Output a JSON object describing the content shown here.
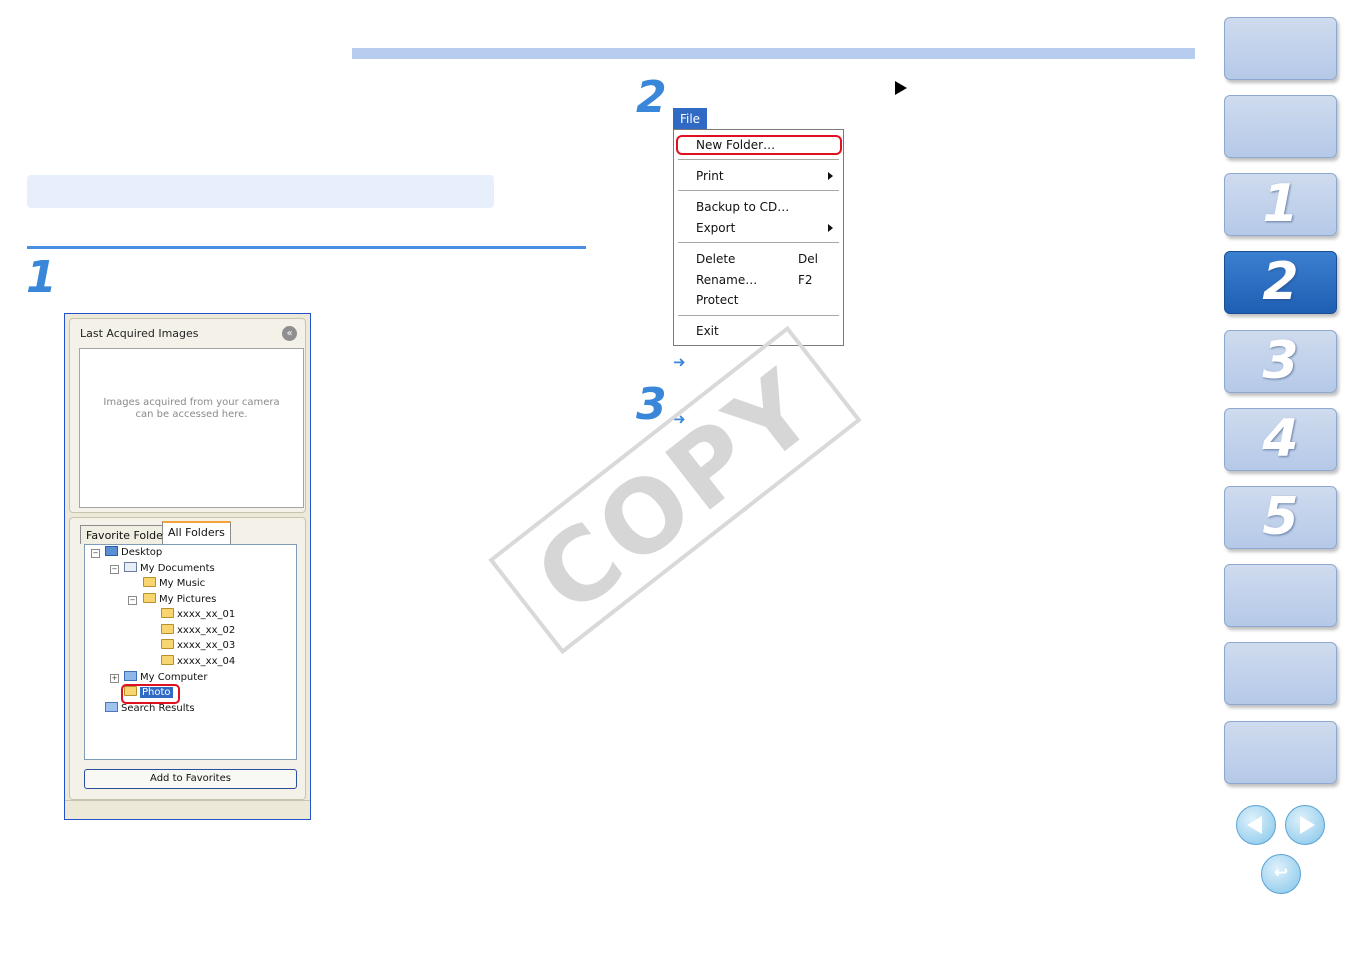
{
  "step1": {
    "number": "1"
  },
  "step2": {
    "number": "2"
  },
  "step3": {
    "number": "3"
  },
  "result_arrow": "➜",
  "browser_panel": {
    "last_acquired_title": "Last Acquired Images",
    "collapse_glyph": "«",
    "placeholder_line1": "Images acquired from your camera",
    "placeholder_line2": "can be accessed here.",
    "tabs": {
      "favorites": "Favorite Folders",
      "all": "All Folders"
    },
    "tree": {
      "desktop": "Desktop",
      "my_documents": "My Documents",
      "my_music": "My Music",
      "my_pictures": "My Pictures",
      "f1": "xxxx_xx_01",
      "f2": "xxxx_xx_02",
      "f3": "xxxx_xx_03",
      "f4": "xxxx_xx_04",
      "my_computer": "My Computer",
      "photo": "Photo",
      "search_results": "Search Results"
    },
    "add_to_favorites": "Add to Favorites"
  },
  "file_menu": {
    "title": "File",
    "items": {
      "new_folder": "New Folder…",
      "print": "Print",
      "backup": "Backup to CD…",
      "export": "Export",
      "delete": "Delete",
      "delete_key": "Del",
      "rename": "Rename…",
      "rename_key": "F2",
      "protect": "Protect",
      "exit": "Exit"
    }
  },
  "watermark": "COPY",
  "nav": {
    "chapters": [
      "1",
      "2",
      "3",
      "4",
      "5"
    ],
    "active_chapter": "2"
  },
  "colors": {
    "accent_blue": "#3a87d9",
    "highlight_red": "#e01020",
    "active_tab": "#2a6cc4",
    "inactive_tab": "#c0d1ec"
  }
}
